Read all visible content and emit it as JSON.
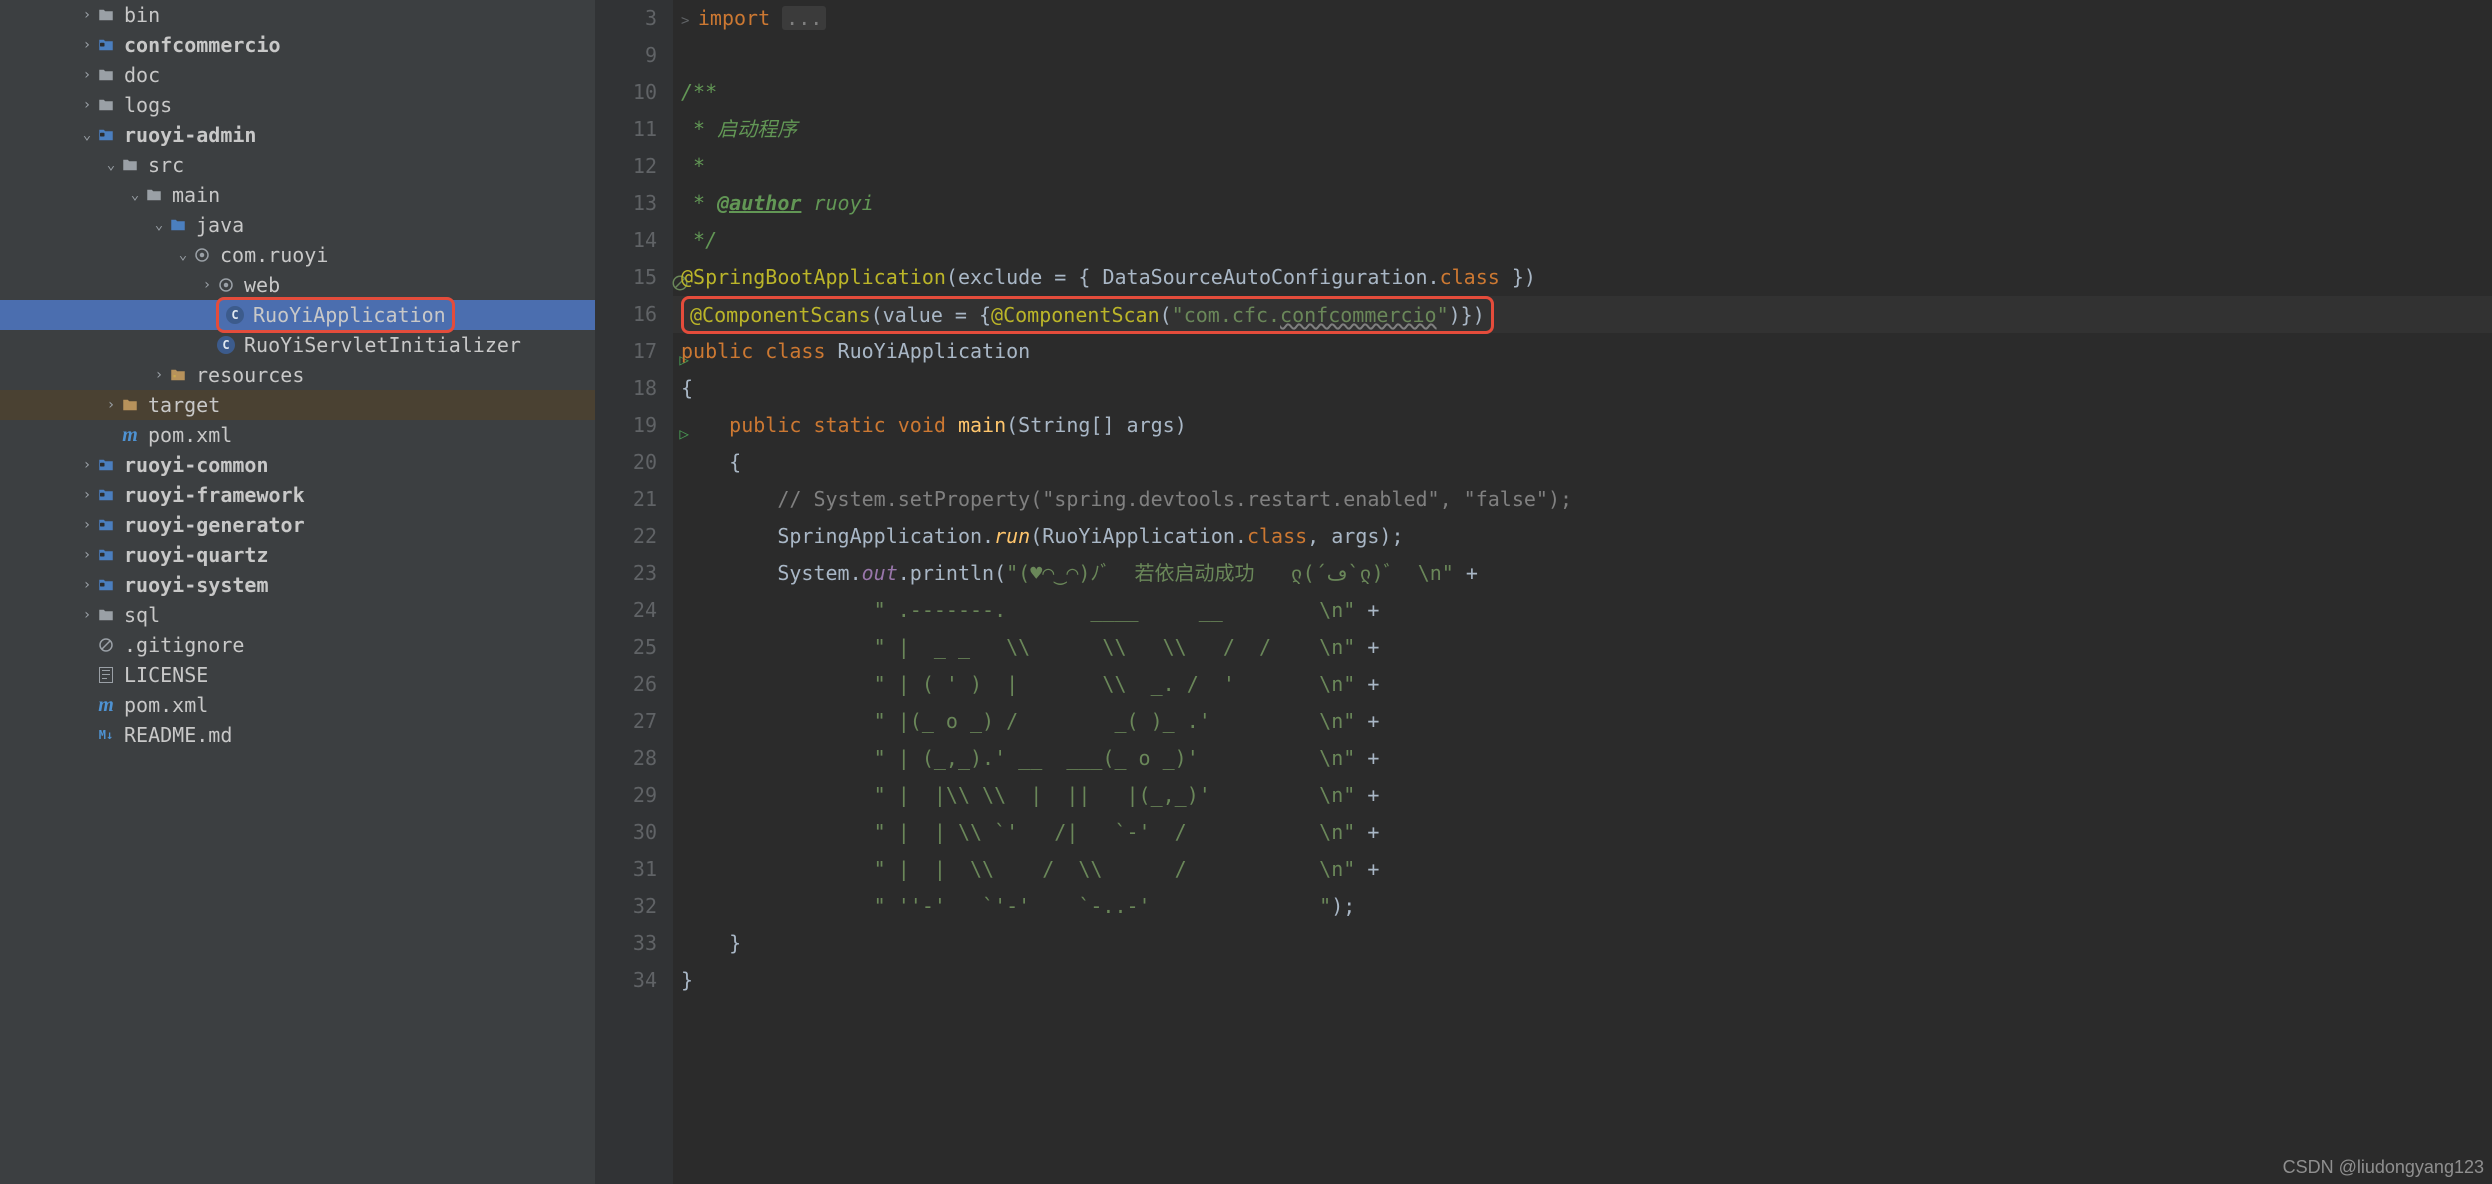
{
  "tree": [
    {
      "d": 2,
      "arrow": ">",
      "iconClass": "folder-grey",
      "icon": "folder",
      "label": "bin",
      "bold": false
    },
    {
      "d": 2,
      "arrow": ">",
      "iconClass": "folder-blue",
      "icon": "module",
      "label": "confcommercio",
      "bold": true
    },
    {
      "d": 2,
      "arrow": ">",
      "iconClass": "folder-grey",
      "icon": "folder",
      "label": "doc",
      "bold": false
    },
    {
      "d": 2,
      "arrow": ">",
      "iconClass": "folder-grey",
      "icon": "folder",
      "label": "logs",
      "bold": false
    },
    {
      "d": 2,
      "arrow": "v",
      "iconClass": "folder-blue",
      "icon": "module",
      "label": "ruoyi-admin",
      "bold": true
    },
    {
      "d": 3,
      "arrow": "v",
      "iconClass": "folder-grey",
      "icon": "folder",
      "label": "src",
      "bold": false
    },
    {
      "d": 4,
      "arrow": "v",
      "iconClass": "folder-grey",
      "icon": "folder",
      "label": "main",
      "bold": false
    },
    {
      "d": 5,
      "arrow": "v",
      "iconClass": "folder-blue",
      "icon": "srcfolder",
      "label": "java",
      "bold": false
    },
    {
      "d": 6,
      "arrow": "v",
      "iconClass": "pkg-icon",
      "icon": "pkg",
      "label": "com.ruoyi",
      "bold": false
    },
    {
      "d": 7,
      "arrow": ">",
      "iconClass": "pkg-icon",
      "icon": "pkg",
      "label": "web",
      "bold": false
    },
    {
      "d": 7,
      "arrow": "",
      "iconClass": "class-icon",
      "icon": "class",
      "label": "RuoYiApplication",
      "bold": false,
      "selected": true,
      "boxed": true
    },
    {
      "d": 7,
      "arrow": "",
      "iconClass": "class-icon",
      "icon": "class",
      "label": "RuoYiServletInitializer",
      "bold": false
    },
    {
      "d": 5,
      "arrow": ">",
      "iconClass": "folder-yellow",
      "icon": "resfolder",
      "label": "resources",
      "bold": false
    },
    {
      "d": 3,
      "arrow": ">",
      "iconClass": "folder-yellow",
      "icon": "folder",
      "label": "target",
      "bold": false,
      "hl": true
    },
    {
      "d": 3,
      "arrow": "",
      "iconClass": "m-icon",
      "icon": "m",
      "label": "pom.xml",
      "bold": false
    },
    {
      "d": 2,
      "arrow": ">",
      "iconClass": "folder-blue",
      "icon": "module",
      "label": "ruoyi-common",
      "bold": true
    },
    {
      "d": 2,
      "arrow": ">",
      "iconClass": "folder-blue",
      "icon": "module",
      "label": "ruoyi-framework",
      "bold": true
    },
    {
      "d": 2,
      "arrow": ">",
      "iconClass": "folder-blue",
      "icon": "module",
      "label": "ruoyi-generator",
      "bold": true
    },
    {
      "d": 2,
      "arrow": ">",
      "iconClass": "folder-blue",
      "icon": "module",
      "label": "ruoyi-quartz",
      "bold": true
    },
    {
      "d": 2,
      "arrow": ">",
      "iconClass": "folder-blue",
      "icon": "module",
      "label": "ruoyi-system",
      "bold": true
    },
    {
      "d": 2,
      "arrow": ">",
      "iconClass": "folder-grey",
      "icon": "folder",
      "label": "sql",
      "bold": false
    },
    {
      "d": 2,
      "arrow": "",
      "iconClass": "forbid-icon",
      "icon": "forbid",
      "label": ".gitignore",
      "bold": false
    },
    {
      "d": 2,
      "arrow": "",
      "iconClass": "txt-icon",
      "icon": "txt",
      "label": "LICENSE",
      "bold": false
    },
    {
      "d": 2,
      "arrow": "",
      "iconClass": "m-icon",
      "icon": "m",
      "label": "pom.xml",
      "bold": false
    },
    {
      "d": 2,
      "arrow": "",
      "iconClass": "md-icon",
      "icon": "md",
      "label": "README.md",
      "bold": false
    }
  ],
  "lineStart": 3,
  "code": {
    "l3": {
      "import": "import ",
      "dots": "..."
    },
    "l10": "/**",
    "l11": " * 启动程序",
    "l12": " * ",
    "l13a": " * ",
    "l13b": "@author",
    "l13c": " ruoyi",
    "l14": " */",
    "l15": {
      "ann": "@SpringBootApplication",
      "rest": "(exclude = { DataSourceAutoConfiguration.",
      "kw": "class",
      "end": " })"
    },
    "l16": {
      "ann1": "@ComponentScans",
      "p1": "(value = {",
      "ann2": "@ComponentScan",
      "p2": "(",
      "str_a": "\"com.cfc.",
      "str_b": "confcommercio",
      "str_c": "\"",
      "p3": ")})"
    },
    "l17": {
      "kw1": "public ",
      "kw2": "class ",
      "name": "RuoYiApplication"
    },
    "l18": "{",
    "l19": {
      "in": "    ",
      "kw": "public static void ",
      "m": "main",
      "rest": "(String[] args)"
    },
    "l20": "    {",
    "l21": {
      "in": "        ",
      "c": "// System.setProperty(\"spring.devtools.restart.enabled\", \"false\");"
    },
    "l22": {
      "in": "        ",
      "a": "SpringApplication.",
      "m": "run",
      "b": "(RuoYiApplication.",
      "kw": "class",
      "c": ", args);"
    },
    "l23": {
      "in": "        ",
      "a": "System.",
      "f": "out",
      "b": ".println(",
      "s": "\"(♥◠‿◠)ﾉﾞ  若依启动成功   ლ(´ڡ`ლ)ﾞ  \\n\"",
      "p": " +"
    },
    "l24": {
      "in": "                ",
      "s": "\" .-------.       ____     __        \\n\"",
      "p": " +"
    },
    "l25": {
      "in": "                ",
      "s": "\" |  _ _   \\\\      \\\\   \\\\   /  /    \\n\"",
      "p": " +"
    },
    "l26": {
      "in": "                ",
      "s": "\" | ( ' )  |       \\\\  _. /  '       \\n\"",
      "p": " +"
    },
    "l27": {
      "in": "                ",
      "s": "\" |(_ o _) /        _( )_ .'         \\n\"",
      "p": " +"
    },
    "l28": {
      "in": "                ",
      "s": "\" | (_,_).' __  ___(_ o _)'          \\n\"",
      "p": " +"
    },
    "l29": {
      "in": "                ",
      "s": "\" |  |\\\\ \\\\  |  ||   |(_,_)'         \\n\"",
      "p": " +"
    },
    "l30": {
      "in": "                ",
      "s": "\" |  | \\\\ `'   /|   `-'  /           \\n\"",
      "p": " +"
    },
    "l31": {
      "in": "                ",
      "s": "\" |  |  \\\\    /  \\\\      /           \\n\"",
      "p": " +"
    },
    "l32": {
      "in": "                ",
      "s": "\" ''-'   `'-'    `-..-'              \"",
      "p": ");"
    },
    "l33": "    }",
    "l34": "}"
  },
  "watermark": "CSDN @liudongyang123"
}
